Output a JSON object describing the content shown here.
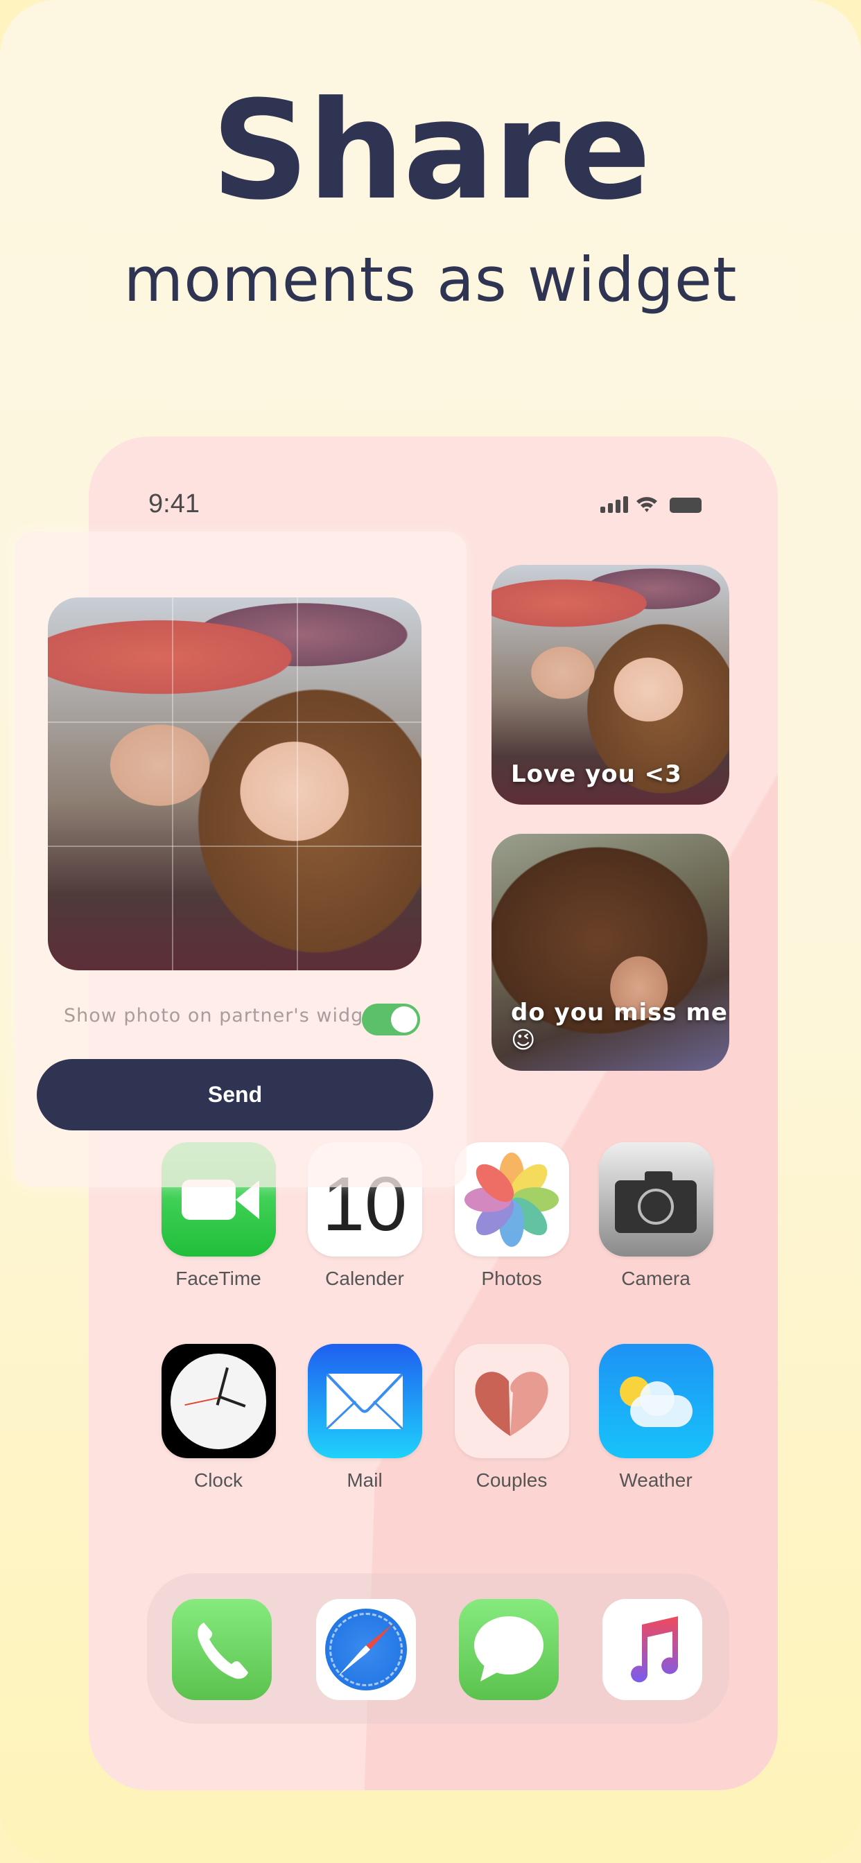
{
  "headline": {
    "title": "Share",
    "subtitle": "moments as widget"
  },
  "status_bar": {
    "time": "9:41",
    "icons": [
      "cellular-signal-icon",
      "wifi-icon",
      "battery-icon"
    ]
  },
  "compose_panel": {
    "photo_description": "couple-selfie-photo",
    "toggle_label": "Show photo on partner's widget",
    "toggle_on": true,
    "send_label": "Send"
  },
  "widgets": [
    {
      "caption": "Love you <3",
      "photo": "couple-selfie-photo"
    },
    {
      "caption": "do you miss me 😉",
      "photo": "woman-portrait-photo"
    }
  ],
  "apps": [
    {
      "label": "FaceTime",
      "icon": "facetime-icon"
    },
    {
      "label": "Calender",
      "icon": "calendar-icon",
      "day": "10"
    },
    {
      "label": "Photos",
      "icon": "photos-icon"
    },
    {
      "label": "Camera",
      "icon": "camera-icon"
    },
    {
      "label": "Clock",
      "icon": "clock-icon"
    },
    {
      "label": "Mail",
      "icon": "mail-icon"
    },
    {
      "label": "Couples",
      "icon": "couples-heart-icon"
    },
    {
      "label": "Weather",
      "icon": "weather-icon"
    }
  ],
  "dock": [
    {
      "icon": "phone-icon"
    },
    {
      "icon": "safari-icon"
    },
    {
      "icon": "messages-icon"
    },
    {
      "icon": "music-icon"
    }
  ],
  "colors": {
    "background": "#fdf6dc",
    "headline": "#2e3452",
    "phone_bg": "#fde2df",
    "send_button": "#2e3452",
    "toggle_on": "#5cbf6a"
  }
}
